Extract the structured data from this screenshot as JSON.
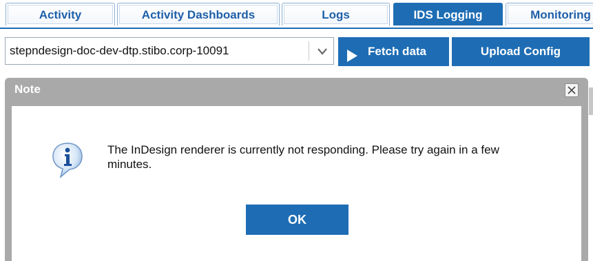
{
  "tabs": [
    {
      "label": "Activity",
      "active": false
    },
    {
      "label": "Activity Dashboards",
      "active": false
    },
    {
      "label": "Logs",
      "active": false
    },
    {
      "label": "IDS Logging",
      "active": true
    },
    {
      "label": "Monitoring",
      "active": false
    }
  ],
  "toolbar": {
    "server_value": "stepndesign-doc-dev-dtp.stibo.corp-10091",
    "fetch_label": "Fetch data",
    "upload_label": "Upload Config"
  },
  "dialog": {
    "title": "Note",
    "message": "The InDesign renderer is currently not responding. Please try again in a few minutes.",
    "ok_label": "OK",
    "icon": "info-icon"
  },
  "colors": {
    "accent": "#1e6db4",
    "modal_header": "#a9a9a9",
    "tab_text": "#1e5fa8"
  }
}
